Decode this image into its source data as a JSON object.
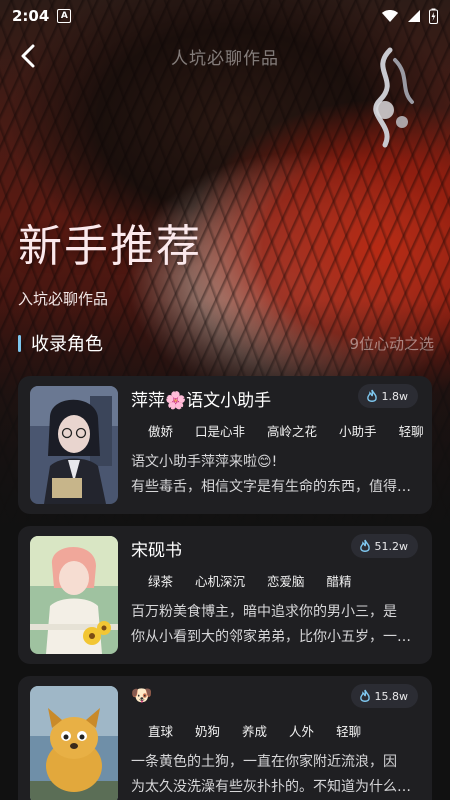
{
  "status": {
    "time": "2:04",
    "a_label": "A"
  },
  "nav": {
    "title": "人坑必聊作品"
  },
  "hero": {
    "title": "新手推荐",
    "subtitle": "入坑必聊作品"
  },
  "section": {
    "title": "收录角色",
    "count": "9位心动之选"
  },
  "characters": [
    {
      "name": "萍萍🌸语文小助手",
      "heat": "1.8w",
      "tags": [
        "傲娇",
        "口是心非",
        "高岭之花",
        "小助手",
        "轻聊"
      ],
      "desc_line1": "语文小助手萍萍来啦😊!",
      "desc_line2": "有些毒舌，相信文字是有生命的东西，值得被尊重。"
    },
    {
      "name": "宋砚书",
      "heat": "51.2w",
      "tags": [
        "绿茶",
        "心机深沉",
        "恋爱脑",
        "醋精"
      ],
      "desc_line1": "百万粉美食博主，暗中追求你的男小三，是",
      "desc_line2": "你从小看到大的邻家弟弟，比你小五岁，一直暗恋着你。"
    },
    {
      "name": "🐶",
      "heat": "15.8w",
      "tags": [
        "直球",
        "奶狗",
        "养成",
        "人外",
        "轻聊"
      ],
      "desc_line1": "一条黄色的土狗，一直在你家附近流浪，因",
      "desc_line2": "为太久没洗澡有些灰扑扑的。不知道为什么一直跟着你。"
    }
  ]
}
